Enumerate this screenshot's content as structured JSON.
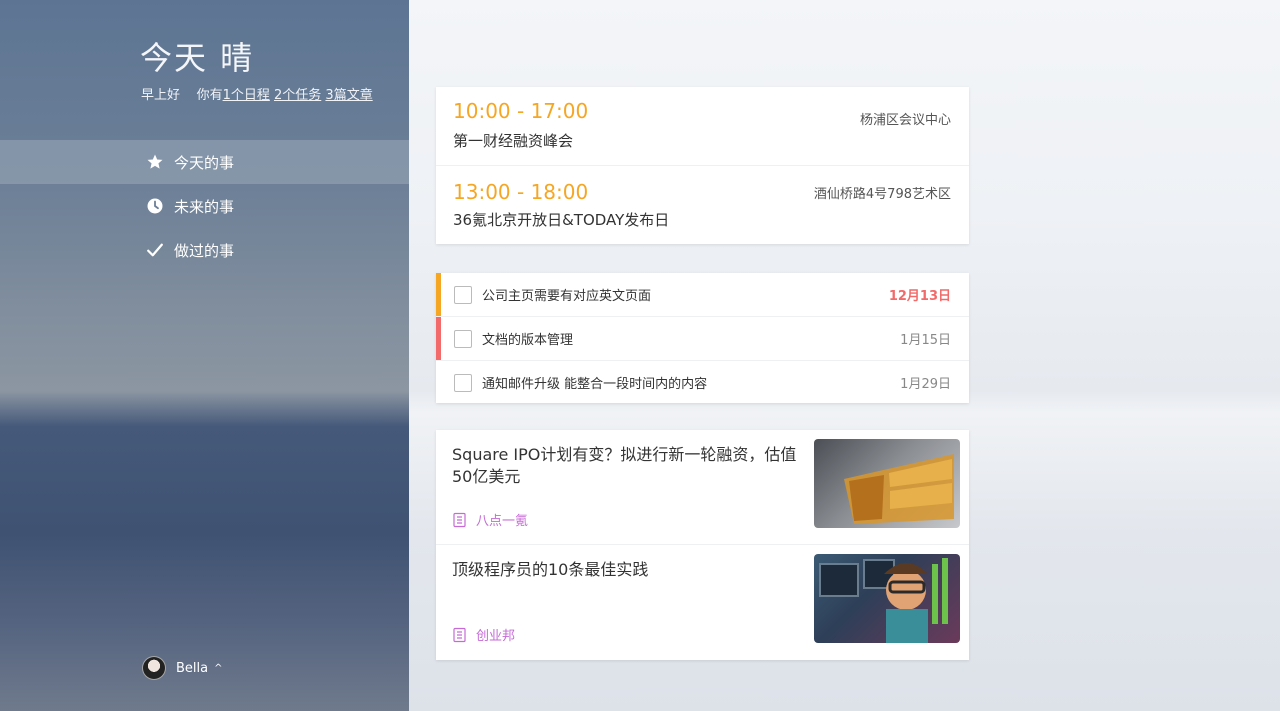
{
  "sidebar": {
    "title": "今天 晴",
    "greeting": "早上好",
    "summary_prefix": "你有",
    "schedule_link": "1个日程",
    "task_link": "2个任务",
    "article_link": "3篇文章",
    "nav": [
      {
        "label": "今天的事",
        "icon": "star-icon"
      },
      {
        "label": "未来的事",
        "icon": "clock-icon"
      },
      {
        "label": "做过的事",
        "icon": "checkmark-icon"
      }
    ],
    "user": {
      "name": "Bella",
      "chevron": "^"
    }
  },
  "schedule": [
    {
      "time": "10:00 - 17:00",
      "title": "第一财经融资峰会",
      "location": "杨浦区会议中心"
    },
    {
      "time": "13:00 - 18:00",
      "title": "36氪北京开放日&TODAY发布日",
      "location": "酒仙桥路4号798艺术区"
    }
  ],
  "tasks": [
    {
      "label": "公司主页需要有对应英文页面",
      "date": "12月13日",
      "priority_color": "#f5a623"
    },
    {
      "label": "文档的版本管理",
      "date": "1月15日",
      "priority_color": "#f26a6a"
    },
    {
      "label": "通知邮件升级 能整合一段时间内的内容",
      "date": "1月29日",
      "priority_color": ""
    }
  ],
  "articles": [
    {
      "title": "Square IPO计划有变？拟进行新一轮融资，估值50亿美元",
      "source": "八点一氪"
    },
    {
      "title": "顶级程序员的10条最佳实践",
      "source": "创业邦"
    }
  ],
  "colors": {
    "accent_orange": "#f5a623",
    "overdue_red": "#f26a6a",
    "source_purple": "#c56ad6"
  }
}
